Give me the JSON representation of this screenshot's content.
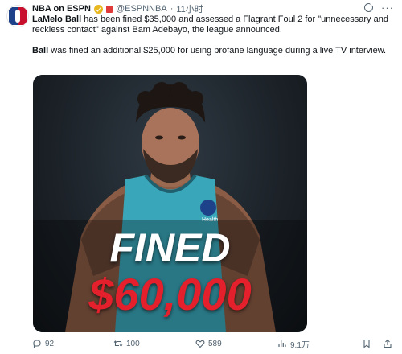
{
  "author": {
    "name": "NBA on ESPN",
    "handle": "@ESPNNBA",
    "time": "11小时",
    "separator": "·"
  },
  "body": {
    "p1_name": "LaMelo Ball",
    "p1_rest": " has been fined $35,000 and assessed a Flagrant Foul 2 for \"unnecessary and reckless contact\" against Bam Adebayo, the league announced.",
    "p2_name": "Ball",
    "p2_rest": " was fined an additional $25,000 for using profane language during a live TV interview."
  },
  "media": {
    "headline_word": "FINED",
    "headline_amount": "$60,000",
    "jersey_patch": "Health"
  },
  "stats": {
    "replies": "92",
    "reposts": "100",
    "likes": "589",
    "views": "9.1万"
  },
  "colors": {
    "accent_red": "#e3202b",
    "jersey_teal": "#3aa6b9",
    "text_secondary": "#536471"
  },
  "icons": [
    "nba-logo",
    "verified-badge-icon",
    "affiliate-badge-icon",
    "grok-icon",
    "more-icon",
    "reply-icon",
    "repost-icon",
    "like-icon",
    "views-icon",
    "bookmark-icon",
    "share-icon"
  ]
}
